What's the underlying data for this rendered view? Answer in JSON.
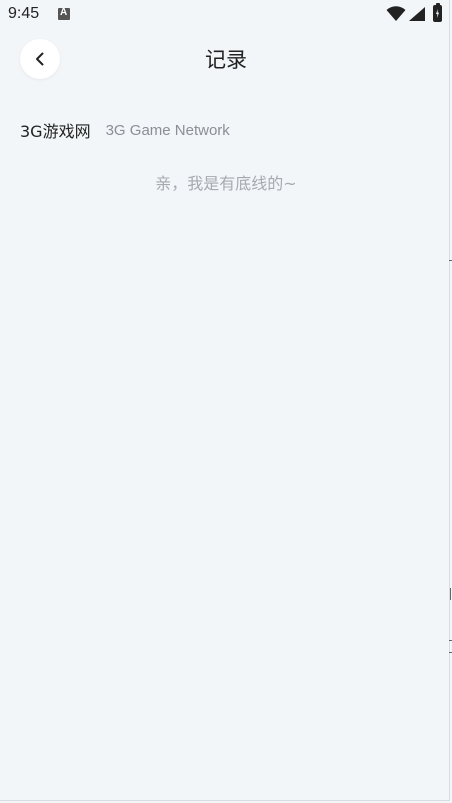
{
  "status_bar": {
    "time": "9:45",
    "notification_icon": "a-letter-icon",
    "wifi_icon": "wifi-icon",
    "signal_icon": "signal-icon",
    "battery_icon": "battery-charging-icon"
  },
  "header": {
    "back_icon": "chevron-left-icon",
    "title": "记录"
  },
  "records": [
    {
      "name": "3G游戏网",
      "subtitle": "3G Game Network"
    }
  ],
  "end_notice": "亲，我是有底线的~",
  "colors": {
    "background": "#f2f6f9",
    "primary_text": "#222222",
    "secondary_text": "#8a8f96",
    "notice_text": "#a6aab0"
  }
}
